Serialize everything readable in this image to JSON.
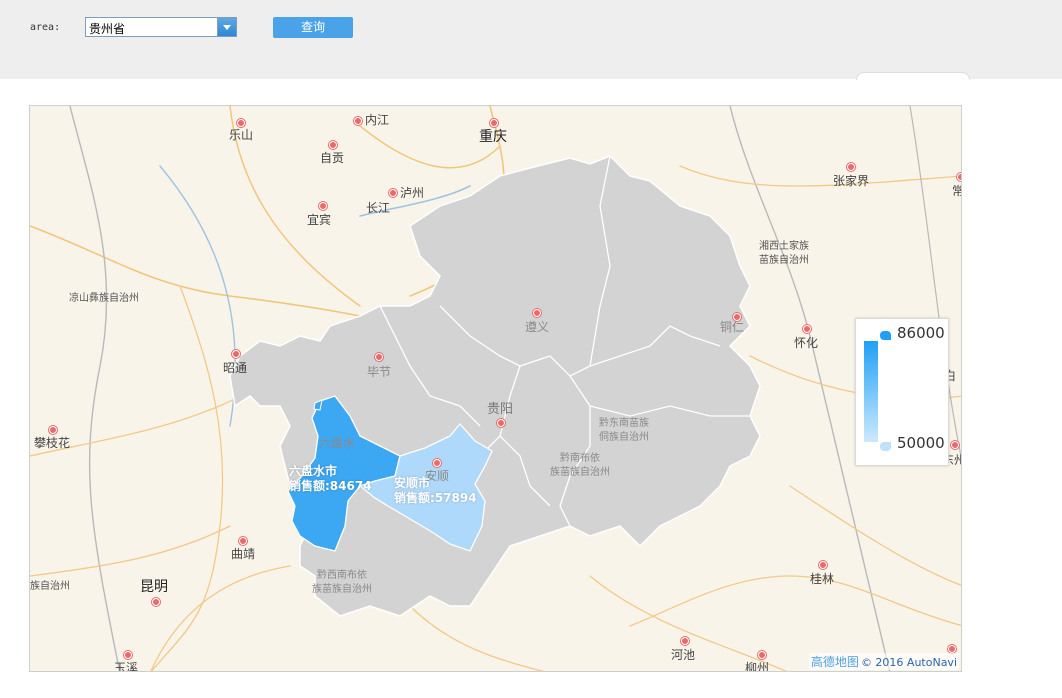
{
  "toolbar": {
    "area_label": "area:",
    "area_select_value": "贵州省",
    "query_label": "查询"
  },
  "map": {
    "cities": [
      {
        "name": "乐山"
      },
      {
        "name": "内江"
      },
      {
        "name": "重庆"
      },
      {
        "name": "自贡"
      },
      {
        "name": "泸州"
      },
      {
        "name": "长江"
      },
      {
        "name": "宜宾"
      },
      {
        "name": "张家界"
      },
      {
        "name": "常"
      },
      {
        "name": "湘西土家族"
      },
      {
        "name": "苗族自治州"
      },
      {
        "name": "凉山彝族自治州"
      },
      {
        "name": "遵义"
      },
      {
        "name": "铜仁"
      },
      {
        "name": "怀化"
      },
      {
        "name": "昭通"
      },
      {
        "name": "毕节"
      },
      {
        "name": "贵阳"
      },
      {
        "name": "攀枝花"
      },
      {
        "name": "六盘水"
      },
      {
        "name": "安顺"
      },
      {
        "name": "黔东南苗族"
      },
      {
        "name": "侗族自治州"
      },
      {
        "name": "黔南布依"
      },
      {
        "name": "族苗族自治州"
      },
      {
        "name": "曲靖"
      },
      {
        "name": "黔西南布依"
      },
      {
        "name": "族苗族自治州"
      },
      {
        "name": "族自治州"
      },
      {
        "name": "昆明"
      },
      {
        "name": "桂林"
      },
      {
        "name": "河池"
      },
      {
        "name": "柳州"
      },
      {
        "name": "玉溪"
      },
      {
        "name": "白"
      },
      {
        "name": "东州"
      }
    ],
    "data_labels": [
      {
        "name": "六盘水市",
        "value_text": "销售额:84674"
      },
      {
        "name": "安顺市",
        "value_text": "销售额:57894"
      }
    ],
    "legend": {
      "max": "86000",
      "min": "50000"
    },
    "attribution": {
      "brand": "高德地图",
      "copyright": "© 2016 AutoNavi"
    },
    "colors": {
      "province_fill": "#d3d3d3",
      "highlight_high": "#3ca7f2",
      "highlight_low": "#aed9fb",
      "background": "#f9f4ea"
    }
  }
}
